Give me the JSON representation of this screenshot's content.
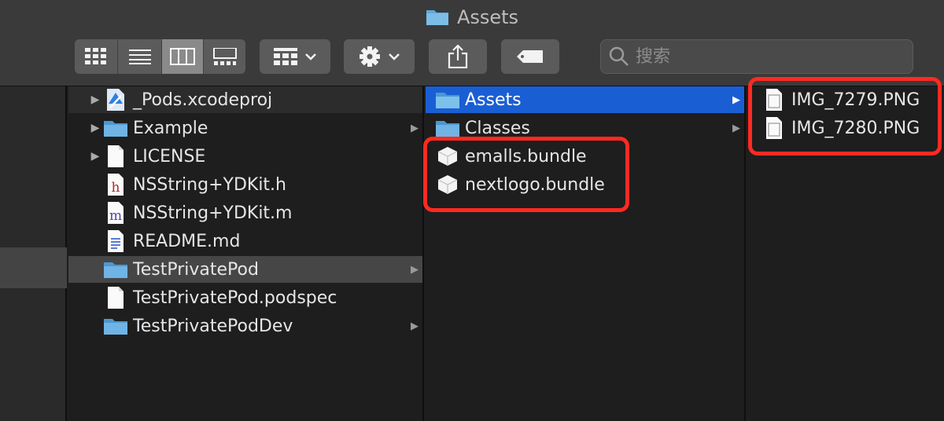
{
  "window": {
    "title": "Assets"
  },
  "toolbar": {
    "view_modes": [
      "icon-view",
      "list-view",
      "column-view",
      "gallery-view"
    ],
    "active_view": "column-view",
    "group_button": "group-grid-icon",
    "action_button": "gear-icon",
    "share_button": "share-icon",
    "tag_button": "tag-icon"
  },
  "search": {
    "placeholder": "搜索"
  },
  "column1": {
    "items": [
      {
        "label": "_Pods.xcodeproj",
        "icon": "xcodeproj-icon",
        "disclosure": true,
        "state": "muted"
      },
      {
        "label": "Example",
        "icon": "folder-icon",
        "disclosure": true,
        "arrow": true
      },
      {
        "label": "LICENSE",
        "icon": "document-icon",
        "disclosure": true
      },
      {
        "label": "NSString+YDKit.h",
        "icon": "header-file-icon"
      },
      {
        "label": "NSString+YDKit.m",
        "icon": "objc-file-icon"
      },
      {
        "label": "README.md",
        "icon": "markdown-file-icon"
      },
      {
        "label": "TestPrivatePod",
        "icon": "folder-icon",
        "arrow": true,
        "state": "selected"
      },
      {
        "label": "TestPrivatePod.podspec",
        "icon": "document-icon"
      },
      {
        "label": "TestPrivatePodDev",
        "icon": "folder-icon",
        "arrow": true
      }
    ]
  },
  "column2": {
    "items": [
      {
        "label": "Assets",
        "icon": "folder-icon",
        "arrow": true,
        "state": "active"
      },
      {
        "label": "Classes",
        "icon": "folder-icon",
        "arrow": true
      },
      {
        "label": "emalls.bundle",
        "icon": "bundle-icon"
      },
      {
        "label": "nextlogo.bundle",
        "icon": "bundle-icon"
      }
    ]
  },
  "column3": {
    "items": [
      {
        "label": "IMG_7279.PNG",
        "icon": "png-file-icon"
      },
      {
        "label": "IMG_7280.PNG",
        "icon": "png-file-icon"
      }
    ]
  },
  "colors": {
    "accent": "#1a5ed4",
    "highlight": "#ff2a22",
    "folder": "#5fa8dc"
  }
}
